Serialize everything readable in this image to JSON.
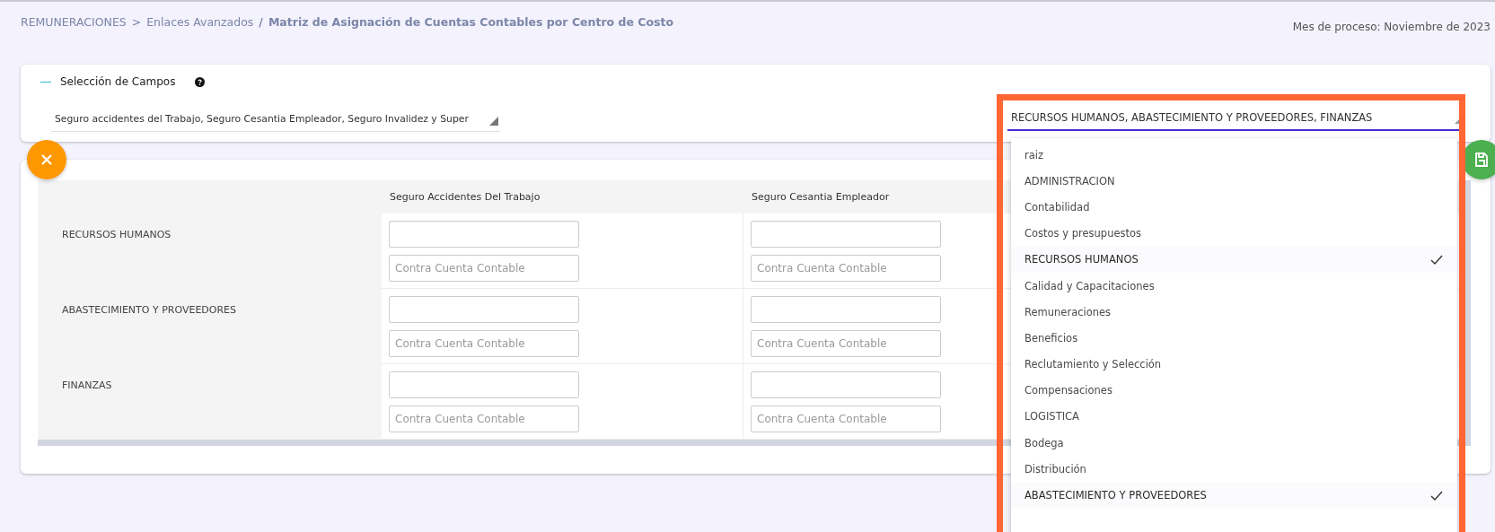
{
  "breadcrumb": {
    "parent": "REMUNERACIONES",
    "separator_1": ">",
    "section": "Enlaces Avanzados",
    "separator_2": "/",
    "title": "Matriz de Asignación de Cuentas Contables por Centro de Costo"
  },
  "process_month": "Mes de proceso: Noviembre de 2023",
  "fields_panel": {
    "toggle": "—",
    "title": "Selección de Campos",
    "expanded": true,
    "fields_select": {
      "value": "Seguro accidentes del Trabajo, Seguro Cesantia Empleador, Seguro Invalidez y Super"
    },
    "cost_center_select": {
      "value": "RECURSOS HUMANOS, ABASTECIMIENTO Y PROVEEDORES, FINANZAS",
      "expanded": true,
      "options": [
        {
          "label": "raiz",
          "selected": false
        },
        {
          "label": "ADMINISTRACION",
          "selected": false
        },
        {
          "label": "Contabilidad",
          "selected": false
        },
        {
          "label": "Costos y presupuestos",
          "selected": false
        },
        {
          "label": "RECURSOS HUMANOS",
          "selected": true
        },
        {
          "label": "Calidad y Capacitaciones",
          "selected": false
        },
        {
          "label": "Remuneraciones",
          "selected": false
        },
        {
          "label": "Beneficios",
          "selected": false
        },
        {
          "label": "Reclutamiento y Selección",
          "selected": false
        },
        {
          "label": "Compensaciones",
          "selected": false
        },
        {
          "label": "LOGISTICA",
          "selected": false
        },
        {
          "label": "Bodega",
          "selected": false
        },
        {
          "label": "Distribución",
          "selected": false
        },
        {
          "label": "ABASTECIMIENTO Y PROVEEDORES",
          "selected": true
        }
      ]
    }
  },
  "matrix": {
    "columns": [
      "Seguro Accidentes Del Trabajo",
      "Seguro Cesantia Empleador"
    ],
    "rows": [
      {
        "name": "RECURSOS HUMANOS",
        "cells": [
          {
            "placeholder": "Contra Cuenta Contable"
          },
          {
            "placeholder": "Contra Cuenta Contable"
          }
        ]
      },
      {
        "name": "ABASTECIMIENTO Y PROVEEDORES",
        "cells": [
          {
            "placeholder": "Contra Cuenta Contable"
          },
          {
            "placeholder": "Contra Cuenta Contable"
          }
        ]
      },
      {
        "name": "FINANZAS",
        "cells": [
          {
            "placeholder": "Contra Cuenta Contable"
          },
          {
            "placeholder": "Contra Cuenta Contable"
          }
        ]
      }
    ]
  }
}
